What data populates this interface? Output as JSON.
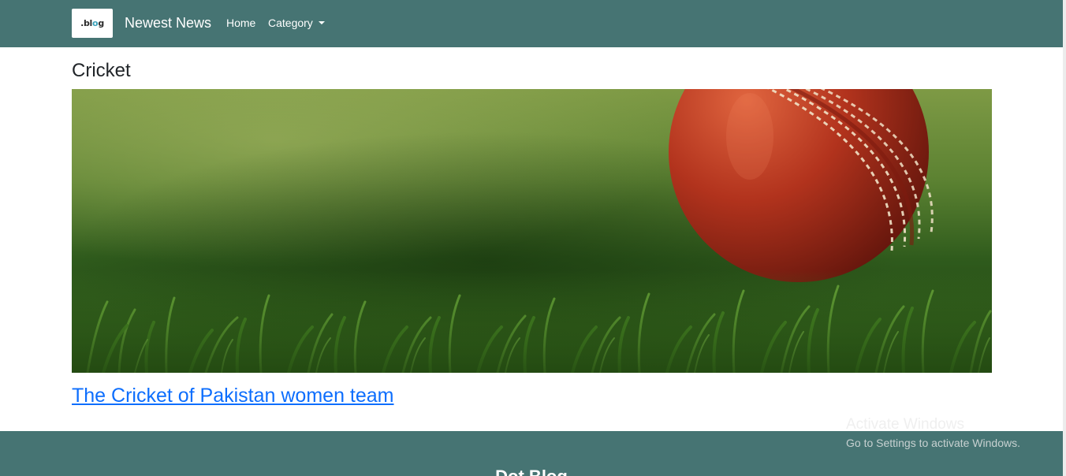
{
  "navbar": {
    "logo_text_prefix": ".bl",
    "logo_text_o": "o",
    "logo_text_suffix": "g",
    "brand": "Newest News",
    "links": [
      {
        "label": "Home"
      },
      {
        "label": "Category"
      }
    ],
    "background": "#467473"
  },
  "main": {
    "category_title": "Cricket",
    "hero_image": {
      "subject": "red cricket ball resting on green grass"
    },
    "article": {
      "title": "The Cricket of Pakistan women team"
    },
    "link_color": "#0d6efd"
  },
  "footer": {
    "title": "Dot Blog",
    "background": "#467473"
  },
  "os_watermark": {
    "title": "Activate Windows",
    "subtitle": "Go to Settings to activate Windows."
  }
}
